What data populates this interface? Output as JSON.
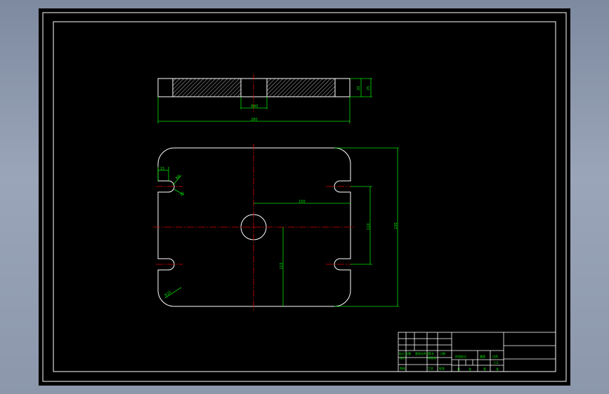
{
  "drawing": {
    "colors": {
      "background": "#000000",
      "frame": "#ffffff",
      "geometry": "#ffffff",
      "dimension": "#00e000",
      "centerline": "#e00000",
      "hatch": "#b8b8b8"
    },
    "side_view": {
      "dim_bore": "Φ40",
      "dim_width": "280",
      "dim_thickness_a": "20",
      "dim_thickness_b": "25"
    },
    "plan_view": {
      "dim_slot_width": "15",
      "dim_slot_radius": "R8",
      "dim_slot_depth": "20",
      "dim_corner_radius": "R25",
      "dim_offset_x": "150",
      "dim_slot_spacing": "110",
      "dim_height": "230",
      "dim_offset_y": "115"
    },
    "title_block": {
      "cell_a": "标记 处数",
      "cell_b": "更改文件号",
      "cell_c": "签名",
      "cell_d": "日期",
      "cell_e": "设计",
      "cell_f": "标准化",
      "cell_g": "审核",
      "cell_h": "工艺",
      "cell_i": "批准",
      "cell_j": "阶段标记",
      "cell_k": "重量",
      "cell_l": "比例",
      "cell_m": "1:2",
      "cell_n": "共",
      "cell_o": "张",
      "cell_p": "第",
      "cell_q": "张"
    }
  }
}
